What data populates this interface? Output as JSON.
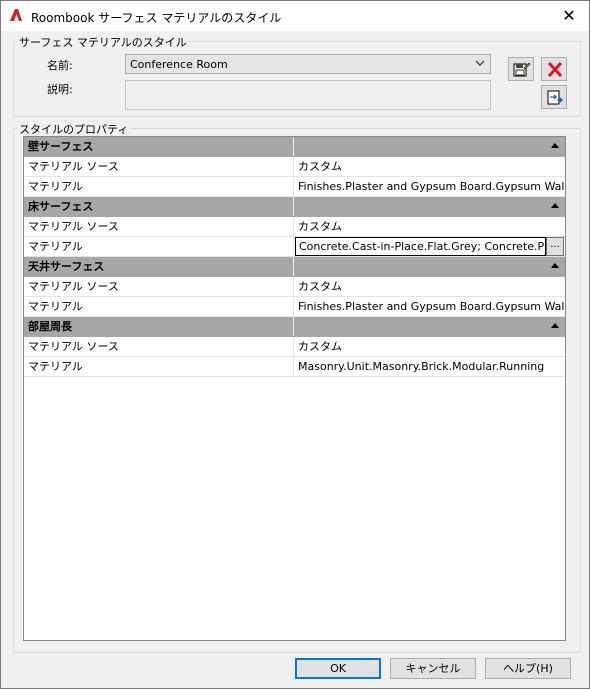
{
  "window": {
    "title": "Roombook サーフェス マテリアルのスタイル"
  },
  "style_group": {
    "legend": "サーフェス マテリアルのスタイル",
    "name_label": "名前:",
    "name_value": "Conference Room",
    "description_label": "説明:",
    "description_value": ""
  },
  "properties_group": {
    "legend": "スタイルのプロパティ",
    "categories": [
      {
        "label": "壁サーフェス",
        "rows": [
          {
            "property": "マテリアル ソース",
            "value": "カスタム"
          },
          {
            "property": "マテリアル",
            "value": "Finishes.Plaster and Gypsum Board.Gypsum Wallb"
          }
        ]
      },
      {
        "label": "床サーフェス",
        "rows": [
          {
            "property": "マテリアル ソース",
            "value": "カスタム"
          },
          {
            "property": "マテリアル",
            "value": "Concrete.Cast-in-Place.Flat.Grey; Concrete.Prec"
          }
        ]
      },
      {
        "label": "天井サーフェス",
        "rows": [
          {
            "property": "マテリアル ソース",
            "value": "カスタム"
          },
          {
            "property": "マテリアル",
            "value": "Finishes.Plaster and Gypsum Board.Gypsum Wallb"
          }
        ]
      },
      {
        "label": "部屋周長",
        "rows": [
          {
            "property": "マテリアル ソース",
            "value": "カスタム"
          },
          {
            "property": "マテリアル",
            "value": "Masonry.Unit.Masonry.Brick.Modular.Running"
          }
        ]
      }
    ]
  },
  "buttons": {
    "ok": "OK",
    "cancel": "キャンセル",
    "help": "ヘルプ(H)"
  },
  "colors": {
    "category_header": "#a7a7a7",
    "delete_icon": "#e81123",
    "default_button_border": "#0078d7"
  }
}
